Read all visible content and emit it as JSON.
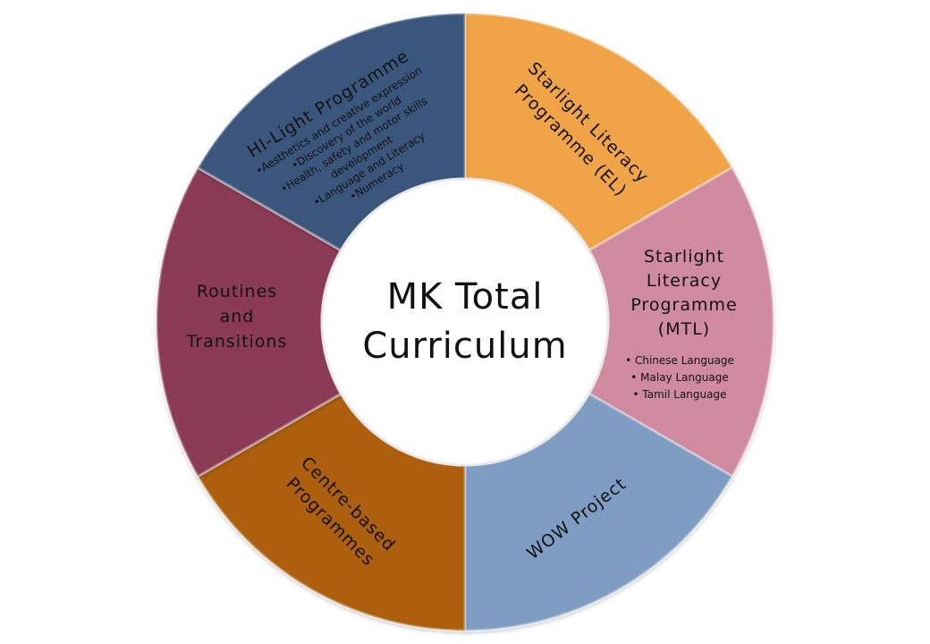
{
  "center": {
    "line1": "MK Total",
    "line2": "Curriculum"
  },
  "segments": [
    {
      "key": "el",
      "color": "#F0A446",
      "title_lines": [
        "Starlight Literacy",
        "Programme (EL)"
      ],
      "items": []
    },
    {
      "key": "mtl",
      "color": "#D08BA1",
      "title_lines": [
        "Starlight",
        "Literacy",
        "Programme",
        "(MTL)"
      ],
      "items": [
        "• Chinese Language",
        "• Malay Language",
        "• Tamil Language"
      ]
    },
    {
      "key": "wow",
      "color": "#7F9CC3",
      "title_lines": [
        "WOW Project"
      ],
      "items": []
    },
    {
      "key": "centre",
      "color": "#AD5E0C",
      "title_lines": [
        "Centre-based",
        "Programmes"
      ],
      "items": []
    },
    {
      "key": "routines",
      "color": "#8B3A55",
      "title_lines": [
        "Routines",
        "and",
        "Transitions"
      ],
      "items": []
    },
    {
      "key": "hilight",
      "color": "#3B577B",
      "title_lines": [
        "HI-Light Programme"
      ],
      "items": [
        "•Aesthetics and creative expression",
        "•Discovery of the world",
        "•Health, safety and motor skills",
        "development",
        "•Language and Literacy",
        "•Numeracy"
      ]
    }
  ]
}
